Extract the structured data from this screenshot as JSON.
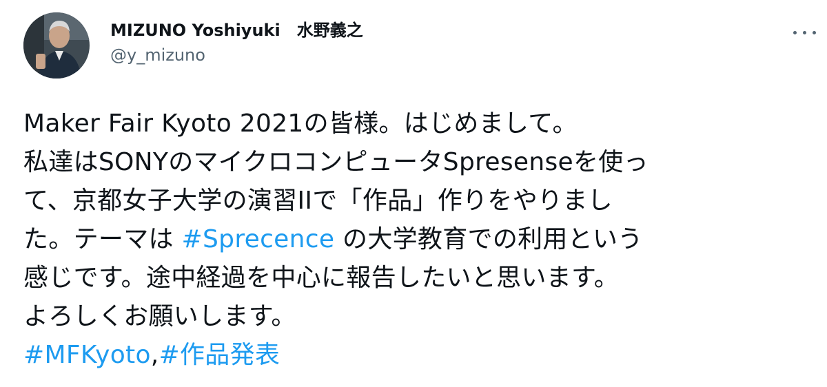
{
  "author": {
    "display_name": "MIZUNO Yoshiyuki　水野義之",
    "handle": "@y_mizuno"
  },
  "tweet": {
    "line1": "Maker Fair Kyoto 2021の皆様。はじめまして。",
    "line2": "私達はSONYのマイクロコンピュータSpresenseを使っ",
    "line3": "て、京都女子大学の演習IIで「作品」作りをやりまし",
    "line4_before": "た。テーマは ",
    "line4_hashtag": "#Sprecence",
    "line4_after": " の大学教育での利用という",
    "line5": "感じです。途中経過を中心に報告したいと思います。",
    "line6": "よろしくお願いします。",
    "hashtag_mfkyoto": "#MFKyoto",
    "hashtag_separator": ",",
    "hashtag_sakuhin": "#作品発表"
  },
  "icons": {
    "more": "more-options-icon",
    "avatar": "profile-photo"
  },
  "colors": {
    "hashtag": "#1d9bf0",
    "text": "#0f1419",
    "secondary": "#536471"
  }
}
